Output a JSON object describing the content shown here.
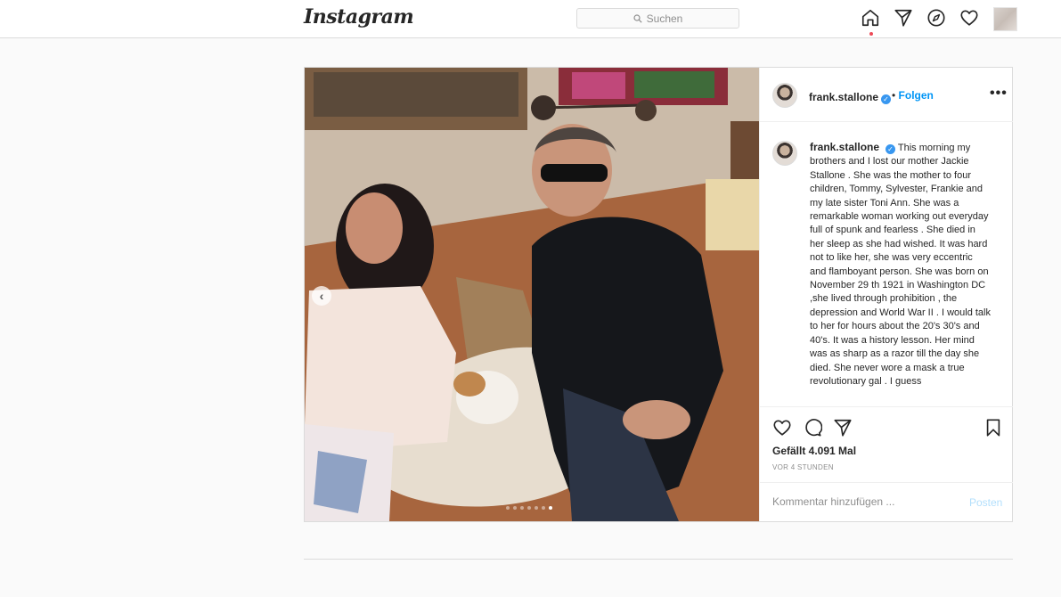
{
  "nav": {
    "logo": "Instagram",
    "search_placeholder": "Suchen",
    "icons": [
      "home-icon",
      "direct-icon",
      "explore-icon",
      "heart-icon"
    ]
  },
  "post": {
    "username": "frank.stallone",
    "follow_separator": "•",
    "follow_label": "Folgen",
    "more_label": "•••",
    "caption": "This morning my brothers and I lost our mother Jackie Stallone . She was the mother to four children, Tommy, Sylvester, Frankie and my late sister Toni Ann. She was a remarkable woman working out everyday full of spunk and fearless . She died in her sleep as she had wished. It was hard not to like her, she was very eccentric and flamboyant person. She was born on November 29 th 1921 in Washington DC ,she lived through prohibition , the depression and World War II . I would talk to her for hours about the 20's 30's and 40's. It was a history lesson. Her mind was as sharp as a razor till the day she died. She never wore a mask a true revolutionary gal . I guess",
    "likes": "Gefällt 4.091 Mal",
    "time": "VOR 4 STUNDEN",
    "comment_placeholder": "Kommentar hinzufügen ...",
    "post_button": "Posten",
    "carousel": {
      "total": 7,
      "active_index": 6,
      "prev_label": "‹"
    }
  },
  "colors": {
    "accent": "#0095f6",
    "post_button_disabled": "#b2dffc",
    "notification_dot": "#ed4956",
    "verified": "#3897f0"
  }
}
